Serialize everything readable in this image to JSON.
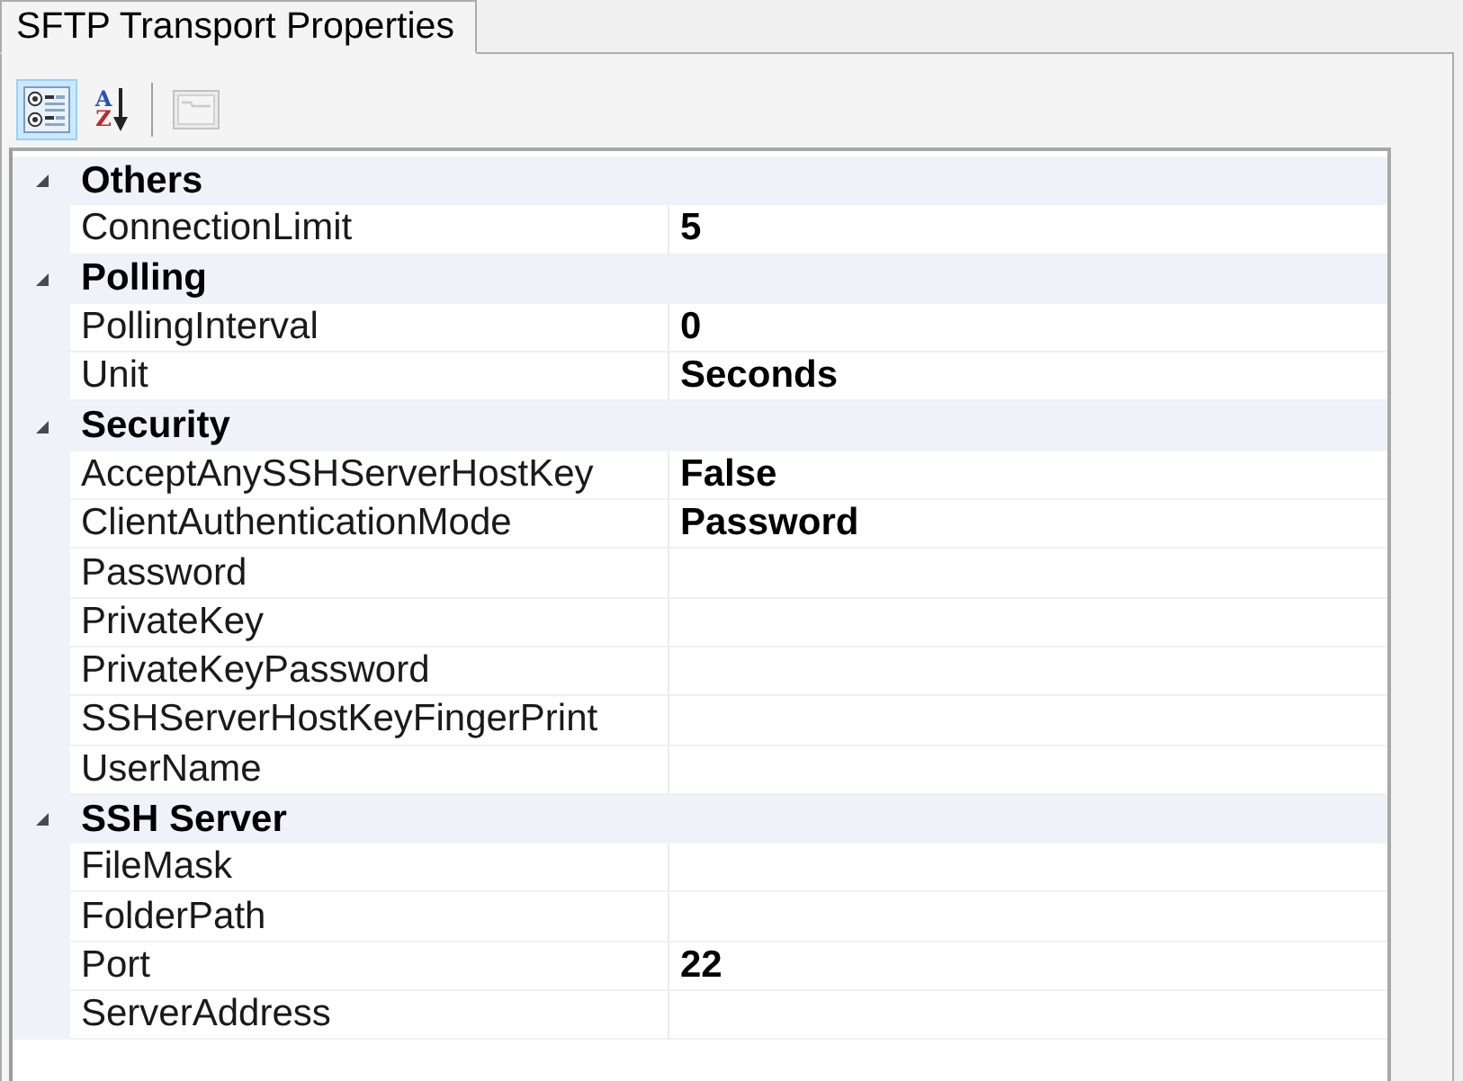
{
  "tabs": [
    {
      "label": "SFTP Transport Properties",
      "selected": true
    }
  ],
  "toolbar": [
    {
      "kind": "categorized",
      "selected": true,
      "disabled": false
    },
    {
      "kind": "alphabetical",
      "selected": false,
      "disabled": false,
      "letters": [
        "A",
        "Z"
      ]
    },
    {
      "kind": "separator"
    },
    {
      "kind": "property_pages",
      "selected": false,
      "disabled": true
    }
  ],
  "property_grid": {
    "categories": [
      {
        "name": "Others",
        "expanded": true,
        "properties": [
          {
            "name": "ConnectionLimit",
            "value": "5"
          }
        ]
      },
      {
        "name": "Polling",
        "expanded": true,
        "properties": [
          {
            "name": "PollingInterval",
            "value": "0"
          },
          {
            "name": "Unit",
            "value": "Seconds"
          }
        ]
      },
      {
        "name": "Security",
        "expanded": true,
        "properties": [
          {
            "name": "AcceptAnySSHServerHostKey",
            "value": "False"
          },
          {
            "name": "ClientAuthenticationMode",
            "value": "Password"
          },
          {
            "name": "Password"
          },
          {
            "name": "PrivateKey"
          },
          {
            "name": "PrivateKeyPassword"
          },
          {
            "name": "SSHServerHostKeyFingerPrint"
          },
          {
            "name": "UserName"
          }
        ]
      },
      {
        "name": "SSH Server",
        "expanded": true,
        "properties": [
          {
            "name": "FileMask"
          },
          {
            "name": "FolderPath"
          },
          {
            "name": "Port",
            "value": "22"
          },
          {
            "name": "ServerAddress"
          }
        ]
      }
    ]
  }
}
